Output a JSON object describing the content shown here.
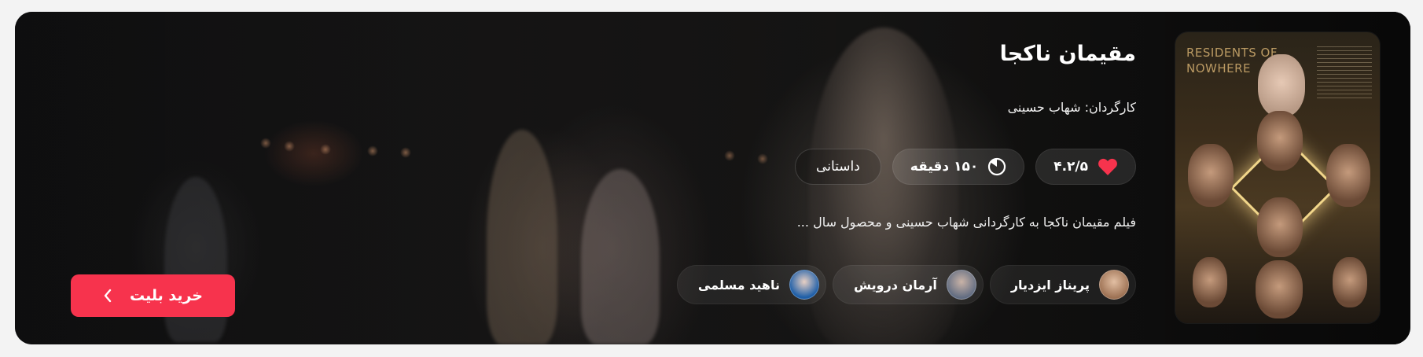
{
  "movie": {
    "title": "مقیمان ناکجا",
    "director": "کارگردان: شهاب حسینی",
    "rating": "۴.۲/۵",
    "duration": "۱۵۰ دقیقه",
    "genre": "داستانی",
    "description": "فیلم مقیمان ناکجا به کارگردانی شهاب حسینی و محصول سال ...",
    "poster_title": "RESIDENTS OF\nNOWHERE"
  },
  "cast": [
    {
      "name": "پریناز ایزدیار",
      "avatar_color": "#c89a78"
    },
    {
      "name": "آرمان درویش",
      "avatar_color": "#8e98a8"
    },
    {
      "name": "ناهید مسلمی",
      "avatar_color": "#2f6fb0"
    }
  ],
  "actions": {
    "buy_label": "خرید بلیت"
  },
  "icons": {
    "rating": "heart-icon",
    "duration": "clock-icon",
    "buy": "chevron-left-icon"
  },
  "colors": {
    "accent": "#f7334d",
    "heart": "#f7334d"
  }
}
